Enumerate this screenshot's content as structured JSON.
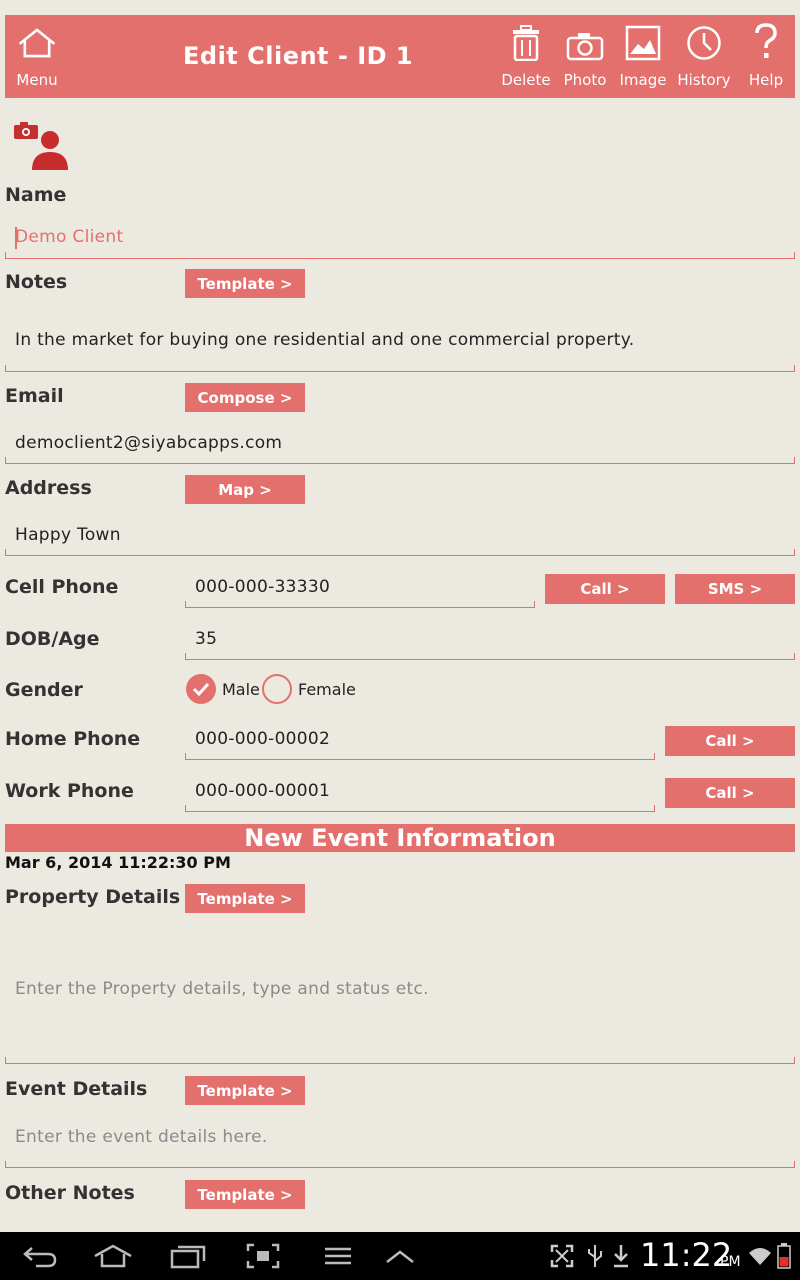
{
  "header": {
    "title": "Edit Client - ID 1",
    "menu_label": "Menu",
    "actions": [
      {
        "id": "delete",
        "label": "Delete",
        "icon": "trash-icon"
      },
      {
        "id": "photo",
        "label": "Photo",
        "icon": "camera-icon"
      },
      {
        "id": "image",
        "label": "Image",
        "icon": "image-icon"
      },
      {
        "id": "history",
        "label": "History",
        "icon": "clock-icon"
      },
      {
        "id": "help",
        "label": "Help",
        "icon": "question-icon"
      }
    ]
  },
  "form": {
    "name": {
      "label": "Name",
      "value": "Demo Client"
    },
    "notes": {
      "label": "Notes",
      "button": "Template >",
      "value": "In the market for buying one residential and one commercial property."
    },
    "email": {
      "label": "Email",
      "button": "Compose >",
      "value": "democlient2@siyabcapps.com"
    },
    "address": {
      "label": "Address",
      "button": "Map >",
      "value": "Happy Town"
    },
    "cell_phone": {
      "label": "Cell Phone",
      "value": "000-000-33330",
      "call": "Call >",
      "sms": "SMS >"
    },
    "dob": {
      "label": "DOB/Age",
      "value": "35"
    },
    "gender": {
      "label": "Gender",
      "options": [
        "Male",
        "Female"
      ],
      "selected": "Male"
    },
    "home_phone": {
      "label": "Home Phone",
      "value": "000-000-00002",
      "call": "Call >"
    },
    "work_phone": {
      "label": "Work Phone",
      "value": "000-000-00001",
      "call": "Call >"
    }
  },
  "event": {
    "section_title": "New Event Information",
    "timestamp": "Mar 6, 2014 11:22:30 PM",
    "property_details": {
      "label": "Property Details",
      "button": "Template >",
      "placeholder": "Enter the Property details, type and status etc."
    },
    "event_details": {
      "label": "Event Details",
      "button": "Template >",
      "placeholder": "Enter the event details here."
    },
    "other_notes": {
      "label": "Other Notes",
      "button": "Template >"
    }
  },
  "status_bar": {
    "time": "11:22",
    "ampm": "PM"
  },
  "colors": {
    "accent": "#e4706d",
    "background": "#ece9e1"
  }
}
